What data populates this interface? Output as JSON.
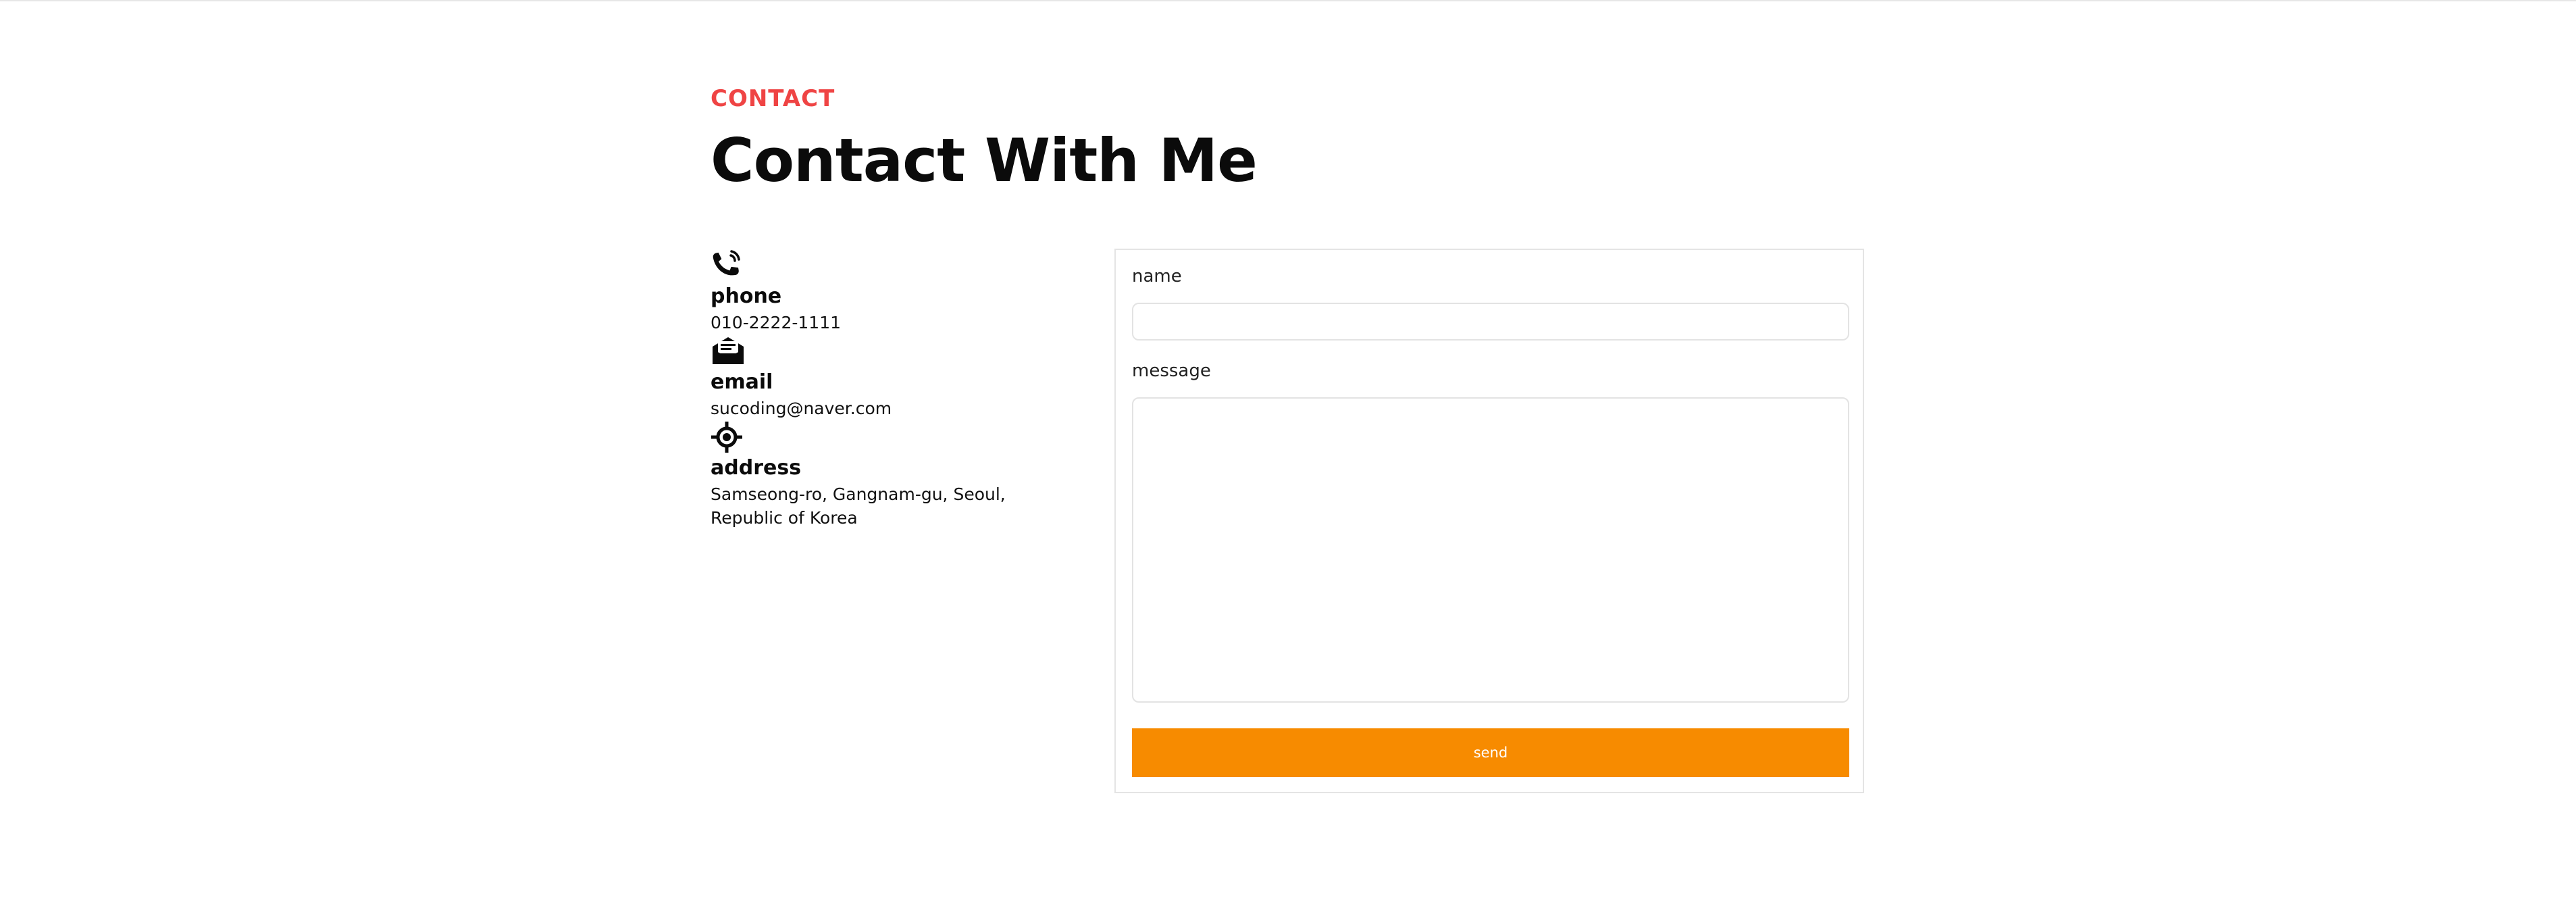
{
  "header": {
    "eyebrow": "CONTACT",
    "title": "Contact With Me"
  },
  "info": {
    "items": [
      {
        "icon": "phone-icon",
        "label": "phone",
        "value": "010-2222-1111"
      },
      {
        "icon": "email-icon",
        "label": "email",
        "value": "sucoding@naver.com"
      },
      {
        "icon": "location-icon",
        "label": "address",
        "value_line1": "Samseong-ro, Gangnam-gu, Seoul,",
        "value_line2": "Republic of Korea"
      }
    ]
  },
  "form": {
    "name_label": "name",
    "name_value": "",
    "message_label": "message",
    "message_value": "",
    "send_label": "send"
  },
  "colors": {
    "accent_red": "#ef4444",
    "button_orange": "#f78b00",
    "border_gray": "#e4e4e4"
  }
}
